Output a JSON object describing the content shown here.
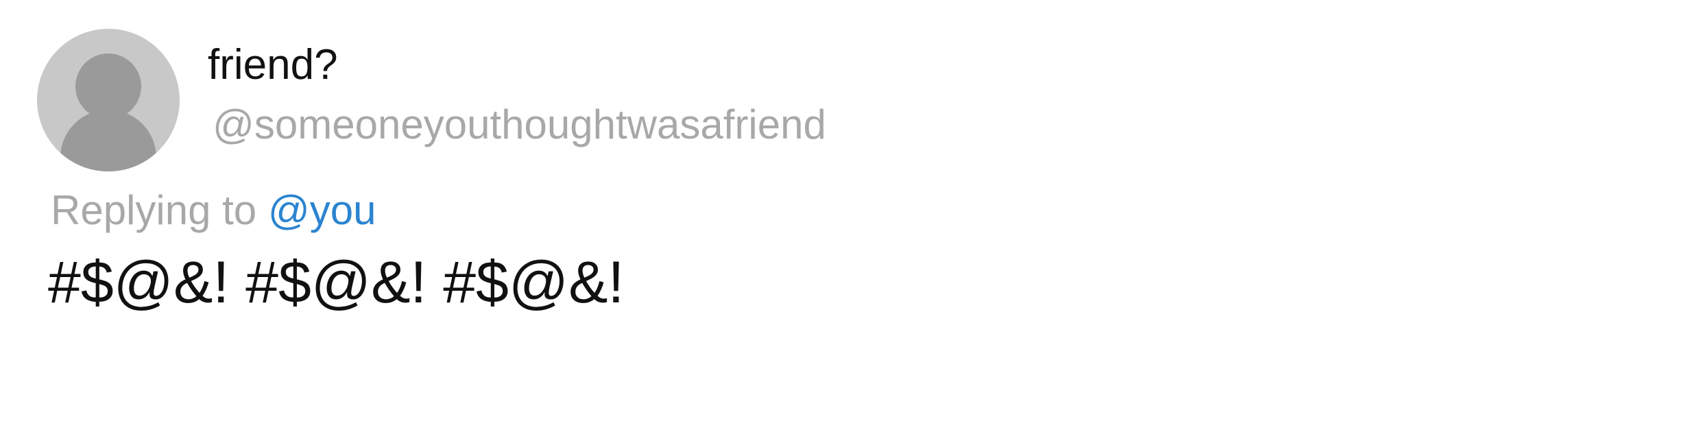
{
  "tweet": {
    "avatar_icon": "default-avatar-icon",
    "display_name": "friend?",
    "handle": "@someoneyouthoughtwasafriend",
    "replying_to_prefix": "Replying to",
    "replying_to_handle": "@you",
    "text": "#$@&! #$@&! #$@&!"
  },
  "colors": {
    "primary_text": "#111111",
    "secondary_text": "#a8a8a8",
    "mention_link": "#2b84d0",
    "avatar_background": "#c8c8c8",
    "avatar_silhouette": "#9a9a9a"
  }
}
